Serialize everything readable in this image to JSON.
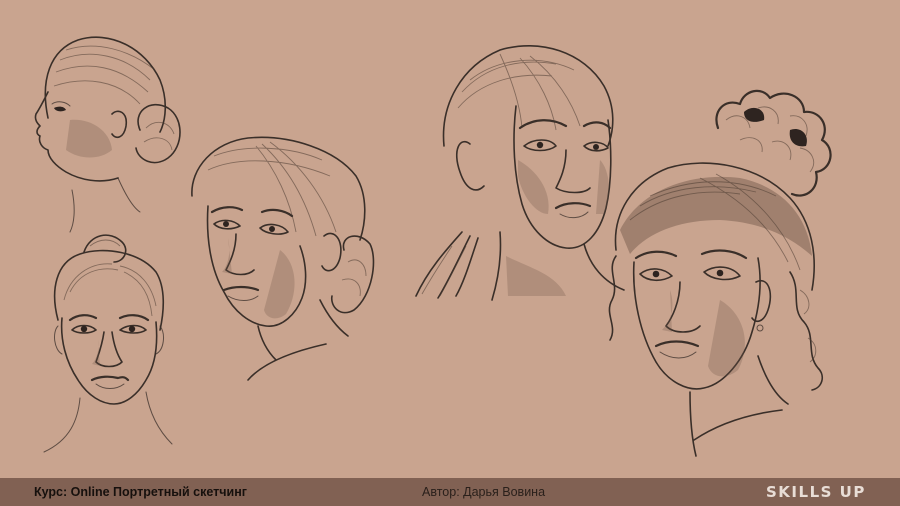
{
  "footer": {
    "course": "Курс: Online Портретный скетчинг",
    "author": "Автор: Дарья Вовина",
    "logo": "SKILLS UP"
  },
  "colors": {
    "background": "#c9a48f",
    "footer_bar": "#816153",
    "pencil": "#3a2f29",
    "logo": "#e8ddd6"
  }
}
